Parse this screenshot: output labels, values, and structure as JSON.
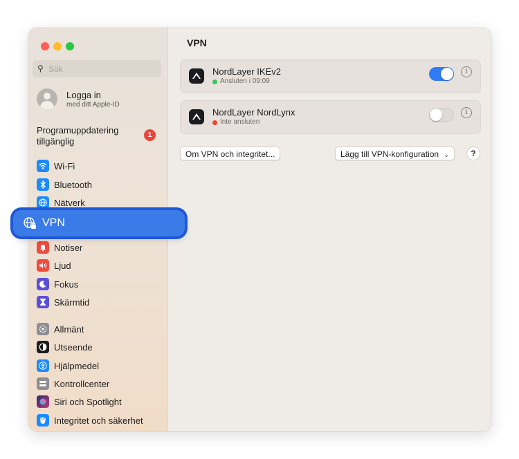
{
  "sidebar": {
    "search_placeholder": "Sök",
    "account": {
      "title": "Logga in",
      "subtitle": "med ditt Apple-ID"
    },
    "update": {
      "label": "Programuppdatering tillgänglig",
      "badge": "1"
    },
    "items": [
      {
        "label": "Wi-Fi",
        "icon": "wifi-icon",
        "color": "#1a8cff"
      },
      {
        "label": "Bluetooth",
        "icon": "bluetooth-icon",
        "color": "#1a8cff"
      },
      {
        "label": "Nätverk",
        "icon": "globe-icon",
        "color": "#1a8cff"
      },
      {
        "label": "VPN",
        "icon": "vpn-globe-icon",
        "color": "#1a8cff"
      },
      {
        "label": "Notiser",
        "icon": "bell-icon",
        "color": "#ef4b3f"
      },
      {
        "label": "Ljud",
        "icon": "speaker-icon",
        "color": "#ef4b3f"
      },
      {
        "label": "Fokus",
        "icon": "moon-icon",
        "color": "#5b4fd6"
      },
      {
        "label": "Skärmtid",
        "icon": "hourglass-icon",
        "color": "#5b4fd6"
      },
      {
        "label": "Allmänt",
        "icon": "gear-icon",
        "color": "#8e8e93"
      },
      {
        "label": "Utseende",
        "icon": "appearance-icon",
        "color": "#1c1c1e"
      },
      {
        "label": "Hjälpmedel",
        "icon": "accessibility-icon",
        "color": "#1a8cff"
      },
      {
        "label": "Kontrollcenter",
        "icon": "control-center-icon",
        "color": "#8e8e93"
      },
      {
        "label": "Siri och Spotlight",
        "icon": "siri-icon",
        "color": "#3b3b8f"
      },
      {
        "label": "Integritet och säkerhet",
        "icon": "hand-icon",
        "color": "#1a8cff"
      }
    ]
  },
  "main": {
    "title": "VPN",
    "connections": [
      {
        "name": "NordLayer IKEv2",
        "status": "Ansluten i 09:09",
        "status_color": "#34c759",
        "enabled": true
      },
      {
        "name": "NordLayer NordLynx",
        "status": "Inte ansluten",
        "status_color": "#ff3b30",
        "enabled": false
      }
    ],
    "about_button": "Om VPN och integritet...",
    "add_button": "Lägg till VPN-konfiguration",
    "help": "?",
    "info": "i"
  },
  "highlight": {
    "label": "VPN"
  }
}
